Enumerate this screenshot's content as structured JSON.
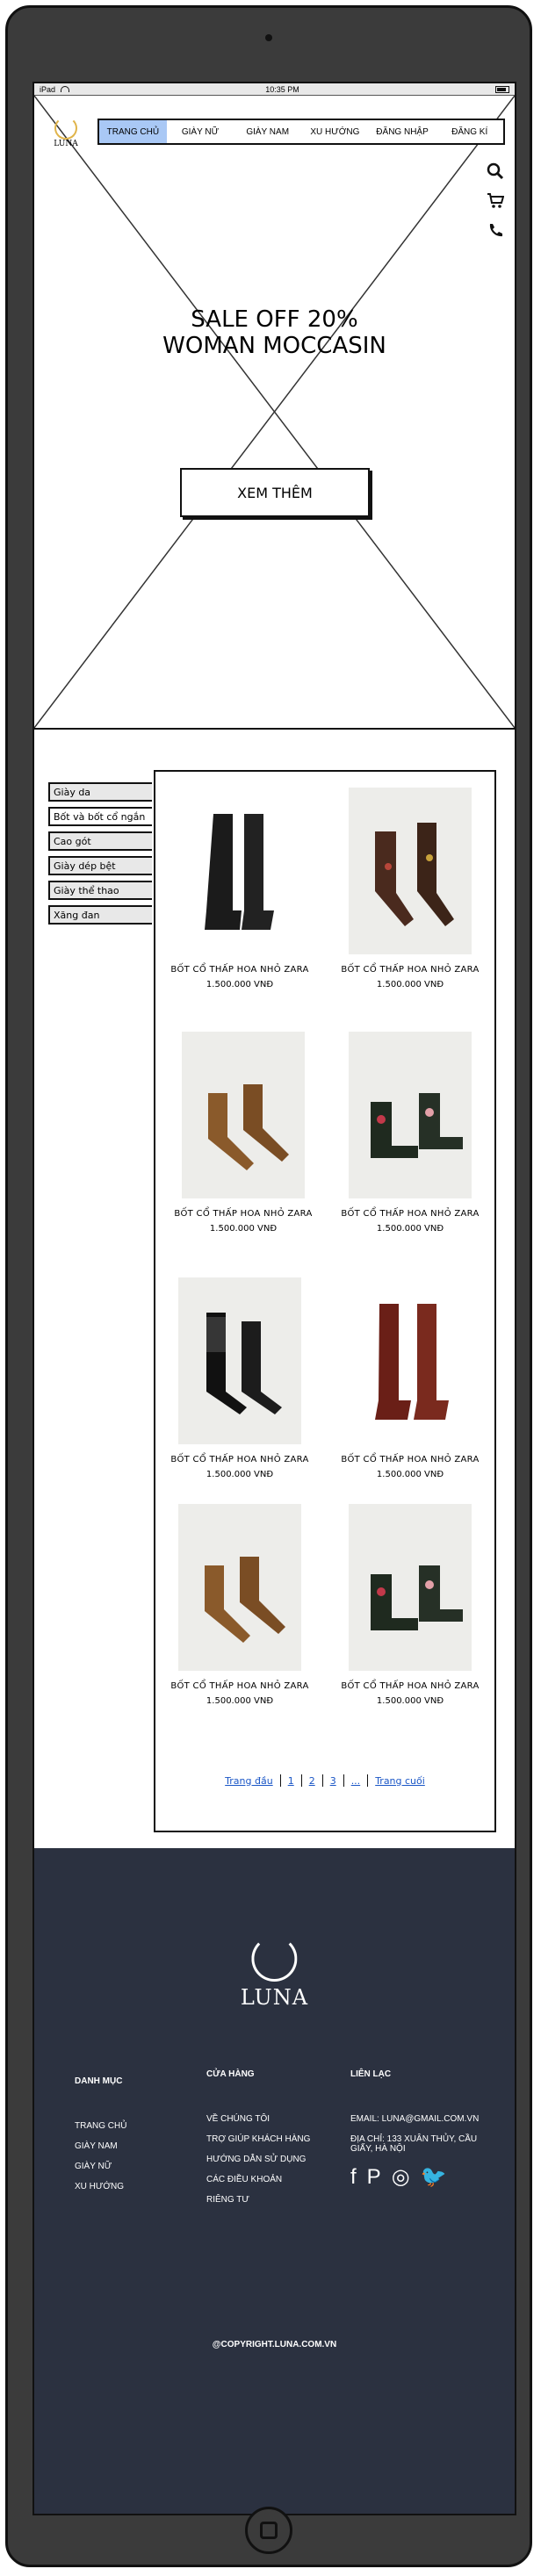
{
  "status": {
    "device": "iPad",
    "time": "10:35 PM"
  },
  "brand": {
    "name": "LUNA"
  },
  "nav": {
    "items": [
      "TRANG CHỦ",
      "GIÀY NỮ",
      "GIÀY NAM",
      "XU HƯỚNG",
      "ĐĂNG NHẬP",
      "ĐĂNG KÍ"
    ],
    "active": "TRANG CHỦ"
  },
  "utility_icons": [
    "search-icon",
    "cart-icon",
    "phone-icon"
  ],
  "hero": {
    "line1": "SALE OFF 20%",
    "line2": "WOMAN MOCCASIN",
    "button": "XEM THÊM"
  },
  "categories": [
    "Giày da",
    "Bốt và bốt cổ ngắn",
    "Cao gót",
    "Giày dép bệt",
    "Giày thể thao",
    "Xăng đan"
  ],
  "products": [
    {
      "name": "BỐT CỔ THẤP HOA NHỎ ZARA",
      "price": "1.500.000 VNĐ"
    },
    {
      "name": "BỐT CỔ THẤP HOA NHỎ ZARA",
      "price": "1.500.000 VNĐ"
    },
    {
      "name": "BỐT CỔ THẤP HOA NHỎ ZARA",
      "price": "1.500.000 VNĐ"
    },
    {
      "name": "BỐT CỔ THẤP HOA NHỎ ZARA",
      "price": "1.500.000 VNĐ"
    },
    {
      "name": "BỐT CỔ THẤP HOA NHỎ ZARA",
      "price": "1.500.000 VNĐ"
    },
    {
      "name": "BỐT CỔ THẤP HOA NHỎ ZARA",
      "price": "1.500.000 VNĐ"
    },
    {
      "name": "BỐT CỔ THẤP HOA NHỎ ZARA",
      "price": "1.500.000 VNĐ"
    },
    {
      "name": "BỐT CỔ THẤP HOA NHỎ ZARA",
      "price": "1.500.000 VNĐ"
    }
  ],
  "pagination": {
    "first": "Trang đầu",
    "pages": [
      "1",
      "2",
      "3",
      "..."
    ],
    "last": "Trang cuối"
  },
  "footer": {
    "brand": "LUNA",
    "col1": {
      "title": "DANH MỤC",
      "links": [
        "TRANG CHỦ",
        "GIÀY NAM",
        "GIÀY NỮ",
        "XU HƯỚNG"
      ]
    },
    "col2": {
      "title": "CỬA HÀNG",
      "links": [
        "VỀ CHÚNG TÔI",
        "TRỢ GIÚP KHÁCH HÀNG",
        "HƯỚNG DẪN SỬ DỤNG",
        "CÁC ĐIỀU KHOẢN",
        "RIÊNG TƯ"
      ]
    },
    "col3": {
      "title": "LIÊN LẠC",
      "email": "EMAIL: LUNA@GMAIL.COM.VN",
      "address": "ĐỊA CHỈ: 133 XUÂN THỦY, CẦU GIẤY, HÀ NỘI",
      "social": [
        "f",
        "P",
        "◎",
        "🐦"
      ]
    },
    "copyright": "@COPYRIGHT.LUNA.COM.VN"
  }
}
